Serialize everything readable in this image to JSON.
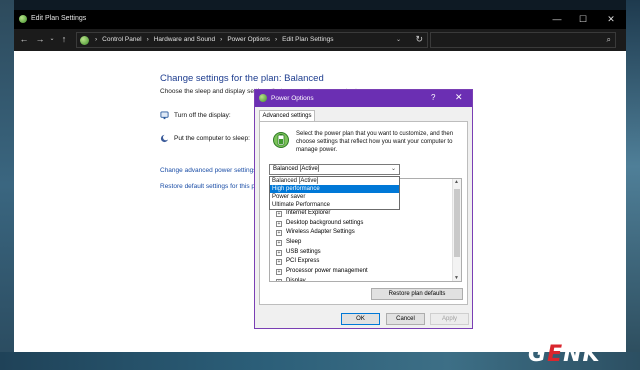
{
  "window": {
    "title": "Edit Plan Settings",
    "controls": {
      "minimize": "—",
      "maximize": "☐",
      "close": "✕"
    }
  },
  "address": {
    "crumbs": [
      "Control Panel",
      "Hardware and Sound",
      "Power Options",
      "Edit Plan Settings"
    ],
    "separator": "›",
    "dropdown_glyph": "⌄",
    "refresh_glyph": "↻",
    "search_placeholder": ""
  },
  "main": {
    "heading": "Change settings for the plan: Balanced",
    "subheading": "Choose the sleep and display settings that you want your computer to use.",
    "display_label": "Turn off the display:",
    "sleep_label": "Put the computer to sleep:",
    "advanced_link": "Change advanced power settings",
    "restore_link": "Restore default settings for this plan"
  },
  "dialog": {
    "title": "Power Options",
    "help": "?",
    "close": "✕",
    "tab": "Advanced settings",
    "description": "Select the power plan that you want to customize, and then choose settings that reflect how you want your computer to manage power.",
    "plan_select": "Balanced [Active]",
    "plan_options": [
      "Balanced [Active]",
      "High performance",
      "Power saver",
      "Ultimate Performance"
    ],
    "selected_option_index": 1,
    "settings_tree": [
      "Internet Explorer",
      "Desktop background settings",
      "Wireless Adapter Settings",
      "Sleep",
      "USB settings",
      "PCI Express",
      "Processor power management",
      "Display"
    ],
    "restore_button": "Restore plan defaults",
    "ok": "OK",
    "cancel": "Cancel",
    "apply": "Apply"
  },
  "watermark": {
    "g": "G",
    "e": "E",
    "nk": "NK"
  },
  "colors": {
    "accent": "#6b2fb3",
    "link": "#1a4da6",
    "selection": "#0078d7",
    "watermark_red": "#d9272e"
  }
}
